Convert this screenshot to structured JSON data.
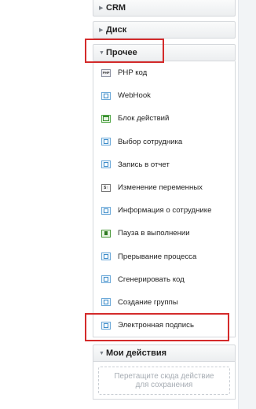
{
  "sections": {
    "crm": {
      "label": "CRM"
    },
    "disk": {
      "label": "Диск"
    },
    "other": {
      "label": "Прочее",
      "items": [
        {
          "label": "PHP код",
          "icon": "php-code-icon",
          "icon_text": "PHP"
        },
        {
          "label": "WebHook",
          "icon": "webhook-icon"
        },
        {
          "label": "Блок действий",
          "icon": "action-block-icon"
        },
        {
          "label": "Выбор сотрудника",
          "icon": "employee-select-icon"
        },
        {
          "label": "Запись в отчет",
          "icon": "report-entry-icon"
        },
        {
          "label": "Изменение переменных",
          "icon": "variables-icon",
          "icon_text": "$↑"
        },
        {
          "label": "Информация о сотруднике",
          "icon": "employee-info-icon"
        },
        {
          "label": "Пауза в выполнении",
          "icon": "pause-icon"
        },
        {
          "label": "Прерывание процесса",
          "icon": "interrupt-process-icon"
        },
        {
          "label": "Сгенерировать код",
          "icon": "generate-code-icon"
        },
        {
          "label": "Создание группы",
          "icon": "create-group-icon"
        },
        {
          "label": "Электронная подпись",
          "icon": "e-signature-icon"
        }
      ]
    },
    "my_actions": {
      "label": "Мои действия",
      "drop_hint_line1": "Перетащите сюда действие",
      "drop_hint_line2": "для сохранения"
    }
  },
  "colors": {
    "highlight": "#d42b2b",
    "icon_blue": "#3d8cc9",
    "icon_green": "#3b8f32"
  }
}
